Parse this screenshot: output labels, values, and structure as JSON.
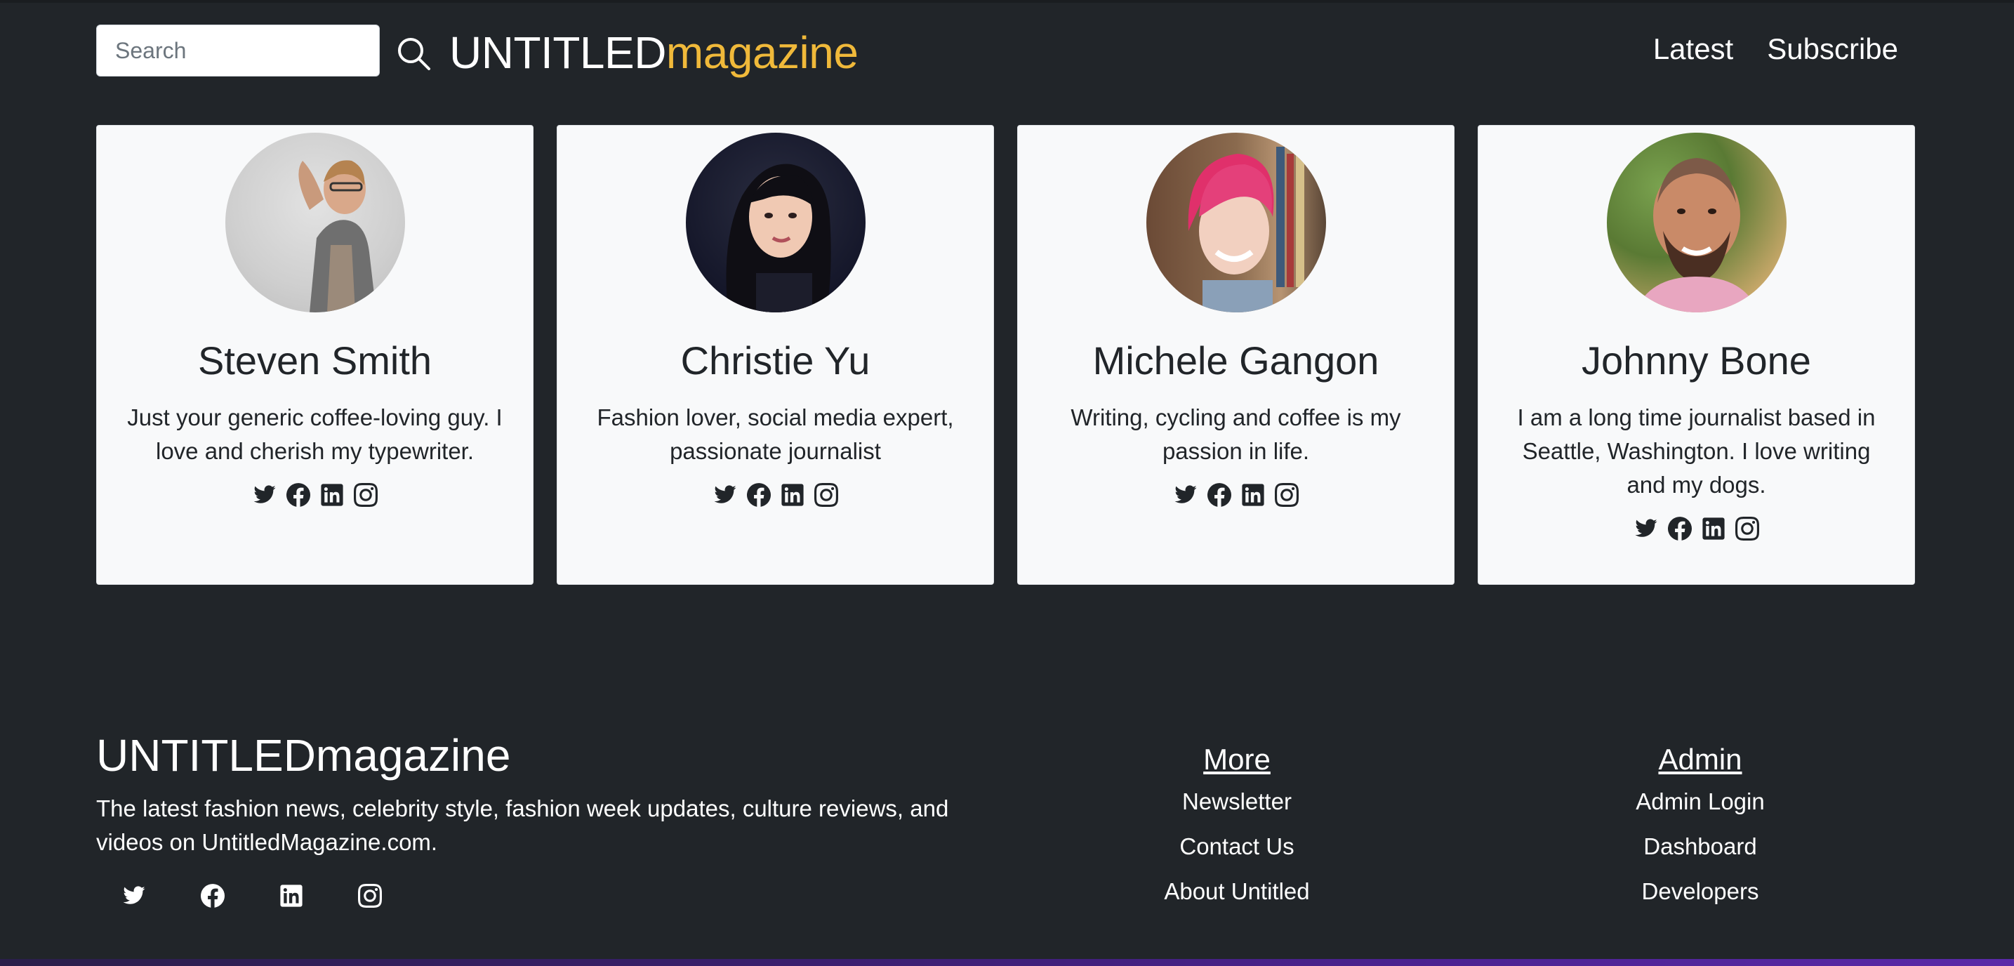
{
  "header": {
    "search_placeholder": "Search",
    "search_icon": "search-icon",
    "brand_part1": "UNTITLED",
    "brand_part2": "magazine",
    "brand_accent": "#f0b93a",
    "nav": [
      {
        "label": "Latest"
      },
      {
        "label": "Subscribe"
      }
    ]
  },
  "authors": [
    {
      "name": "Steven Smith",
      "bio": "Just your generic coffee-loving guy. I love and cherish my typewriter.",
      "avatar": "avatar-photo"
    },
    {
      "name": "Christie Yu",
      "bio": "Fashion lover, social media expert, passionate journalist",
      "avatar": "avatar-photo"
    },
    {
      "name": "Michele Gangon",
      "bio": "Writing, cycling and coffee is my passion in life.",
      "avatar": "avatar-photo"
    },
    {
      "name": "Johnny Bone",
      "bio": "I am a long time journalist based in Seattle, Washington. I love writing and my dogs.",
      "avatar": "avatar-photo"
    }
  ],
  "social_icons": [
    "twitter-icon",
    "facebook-icon",
    "linkedin-icon",
    "instagram-icon"
  ],
  "footer": {
    "brand": "UNTITLEDmagazine",
    "description": "The latest fashion news, celebrity style, fashion week updates, culture reviews, and videos on UntitledMagazine.com.",
    "columns": [
      {
        "title": "More",
        "links": [
          "Newsletter",
          "Contact Us",
          "About Untitled"
        ]
      },
      {
        "title": "Admin",
        "links": [
          "Admin Login",
          "Dashboard",
          "Developers"
        ]
      }
    ]
  }
}
